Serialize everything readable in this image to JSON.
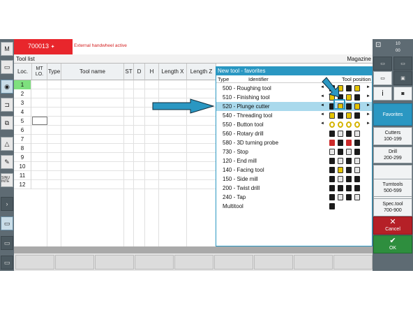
{
  "header": {
    "alarm_number": "700013",
    "alarm_text": "External handwheel active"
  },
  "toollist": {
    "title": "Tool list",
    "magazine_label": "Magazine",
    "columns": [
      {
        "label": "Loc."
      },
      {
        "label": "MT LO."
      },
      {
        "label": "Type"
      },
      {
        "label": "Tool name"
      },
      {
        "label": "ST"
      },
      {
        "label": "D"
      },
      {
        "label": "H"
      },
      {
        "label": "Length X"
      },
      {
        "label": "Length Z"
      }
    ],
    "rows": [
      "1",
      "2",
      "3",
      "4",
      "5",
      "6",
      "7",
      "8",
      "9",
      "10",
      "11",
      "12"
    ]
  },
  "dialog": {
    "title": "New tool - favorites",
    "col_type": "Type",
    "col_identifier": "Identifier",
    "col_position": "Tool position",
    "items": [
      {
        "label": "500 - Roughing tool"
      },
      {
        "label": "510 - Finishing tool"
      },
      {
        "label": "520 - Plunge cutter",
        "selected": true
      },
      {
        "label": "540 - Threading tool"
      },
      {
        "label": "550 - Button tool"
      },
      {
        "label": "560 - Rotary drill"
      },
      {
        "label": "580 - 3D turning probe"
      },
      {
        "label": "730 - Stop"
      },
      {
        "label": "120 - End mill"
      },
      {
        "label": "140 - Facing tool"
      },
      {
        "label": "150 - Side mill"
      },
      {
        "label": "200 - Twist drill"
      },
      {
        "label": "240 - Tap"
      },
      {
        "label": "     Multitool"
      }
    ],
    "arrow_left": "◄",
    "arrow_right": "►"
  },
  "right_softkeys": {
    "favorites": "Favorites",
    "cutters": "Cutters",
    "cutters_range": "100-199",
    "drill": "Drill",
    "drill_range": "200-299",
    "turntools": "Turntools",
    "turntools_range": "500-599",
    "spec_tool": "Spec.tool",
    "spec_tool_range": "700-900",
    "cancel_symbol": "✕",
    "cancel": "Cancel",
    "ok_symbol": "✔",
    "ok": "OK",
    "info_symbol": "i",
    "counter_top": "10",
    "counter_bottom": "00"
  },
  "left_toolbar": {
    "m_label": "M",
    "sinumerik": "SINU INTE"
  },
  "colors": {
    "accent": "#2a97c2",
    "alarm": "#e8262c",
    "active_row": "#7ee07e",
    "cancel": "#b52027",
    "ok": "#2e8e3e"
  }
}
